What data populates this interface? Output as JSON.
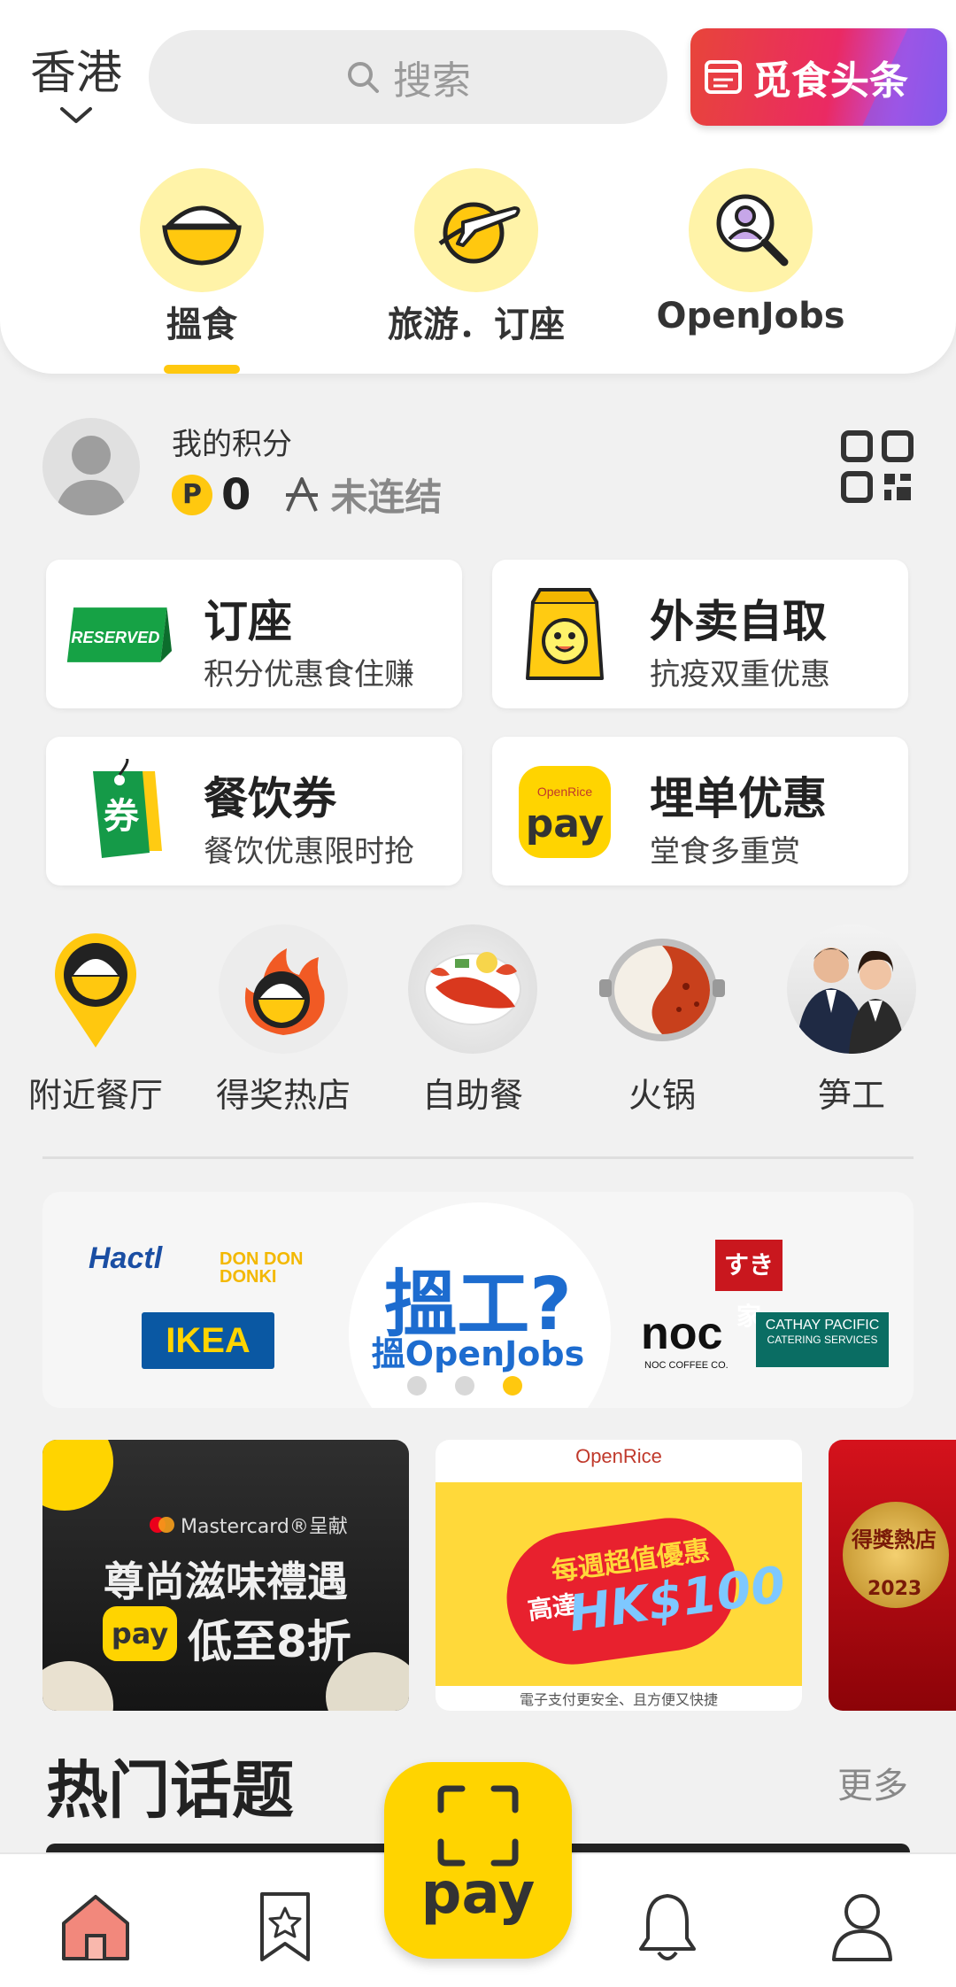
{
  "header": {
    "region": "香港",
    "search_placeholder": "搜索",
    "news_badge": "觅食头条"
  },
  "categories": [
    {
      "label": "搵食",
      "icon": "rice-bowl-icon",
      "active": true
    },
    {
      "label": "旅游．订座",
      "icon": "plane-icon",
      "active": false
    },
    {
      "label": "OpenJobs",
      "icon": "magnifier-person-icon",
      "active": false
    }
  ],
  "points": {
    "title": "我的积分",
    "coin_label": "P",
    "value": "0",
    "link_status": "未连结"
  },
  "services": [
    {
      "title": "订座",
      "subtitle": "积分优惠食住赚",
      "icon": "reserved-sign-icon",
      "icon_text": "RESERVED"
    },
    {
      "title": "外卖自取",
      "subtitle": "抗疫双重优惠",
      "icon": "takeaway-bag-icon"
    },
    {
      "title": "餐饮券",
      "subtitle": "餐饮优惠限时抢",
      "icon": "voucher-tag-icon",
      "icon_text": "券"
    },
    {
      "title": "埋单优惠",
      "subtitle": "堂食多重赏",
      "icon": "openrice-pay-icon",
      "icon_text": "pay"
    }
  ],
  "quick_links": [
    {
      "label": "附近餐厅",
      "icon": "location-pin-icon"
    },
    {
      "label": "得奖热店",
      "icon": "fire-bowl-icon"
    },
    {
      "label": "自助餐",
      "icon": "lobster-icon"
    },
    {
      "label": "火锅",
      "icon": "hotpot-icon"
    },
    {
      "label": "笋工",
      "icon": "staff-icon"
    }
  ],
  "banner": {
    "headline": "搵工?",
    "sub": "搵OpenJobs",
    "logos": [
      "Hactl",
      "DON DON DONKI",
      "IKEA",
      "すき家",
      "noc",
      "NOC COFFEE CO.",
      "CATHAY PACIFIC",
      "CATERING SERVICES"
    ],
    "active_dot": 2
  },
  "promos": [
    {
      "brand": "Mastercard®呈献",
      "title": "尊尚滋味禮遇",
      "badge": "pay",
      "discount": "低至8折"
    },
    {
      "brand": "OpenRice",
      "title": "每週超值優惠",
      "amount": "HK$100",
      "prefix": "高達",
      "footnote": "電子支付更安全、且方便又快捷"
    },
    {
      "title": "得獎熱店",
      "year": "2023"
    }
  ],
  "hot_topics": {
    "title": "热门话题",
    "more": "更多"
  },
  "bottom_nav": {
    "pay_label": "pay",
    "items": [
      "home-icon",
      "bookmark-star-icon",
      "bell-icon",
      "profile-icon"
    ]
  },
  "colors": {
    "accent": "#ffc80f",
    "fab": "#ffd400",
    "home_active": "#f2887c",
    "banner_blue": "#1d6ccf"
  }
}
